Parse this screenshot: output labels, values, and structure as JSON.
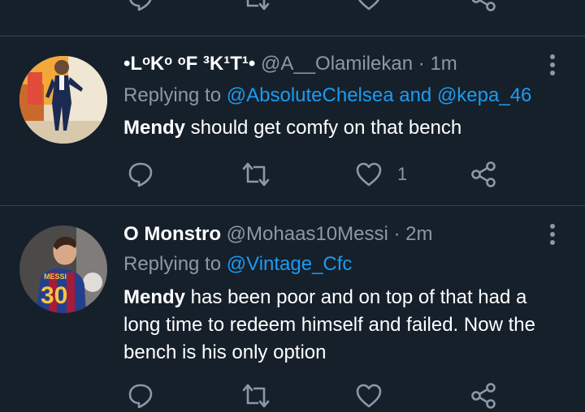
{
  "tweets": [
    {
      "name": "•LᵒKᵒ ᵒF ³K¹T¹•",
      "handle": "@A__Olamilekan",
      "separator": "·",
      "time": "1m",
      "replying_prefix": "Replying to",
      "replying_to": "@AbsoluteChelsea and @kepa_46",
      "body_bold": "Mendy",
      "body_rest": " should get comfy on that bench",
      "like_count": "1"
    },
    {
      "name": "O Monstro",
      "handle": "@Mohaas10Messi",
      "separator": "·",
      "time": "2m",
      "replying_prefix": "Replying to",
      "replying_to": "@Vintage_Cfc",
      "body_bold": "Mendy",
      "body_rest": " has been poor and on top of that had a long time to redeem himself and failed. Now the bench is his only option",
      "like_count": ""
    }
  ],
  "colors": {
    "background": "#15202b",
    "divider": "#38444d",
    "muted": "#8b98a5",
    "accent": "#1d9bf0",
    "text": "#ffffff"
  },
  "icons": [
    "reply-icon",
    "retweet-icon",
    "like-icon",
    "share-icon",
    "more-options-icon"
  ]
}
